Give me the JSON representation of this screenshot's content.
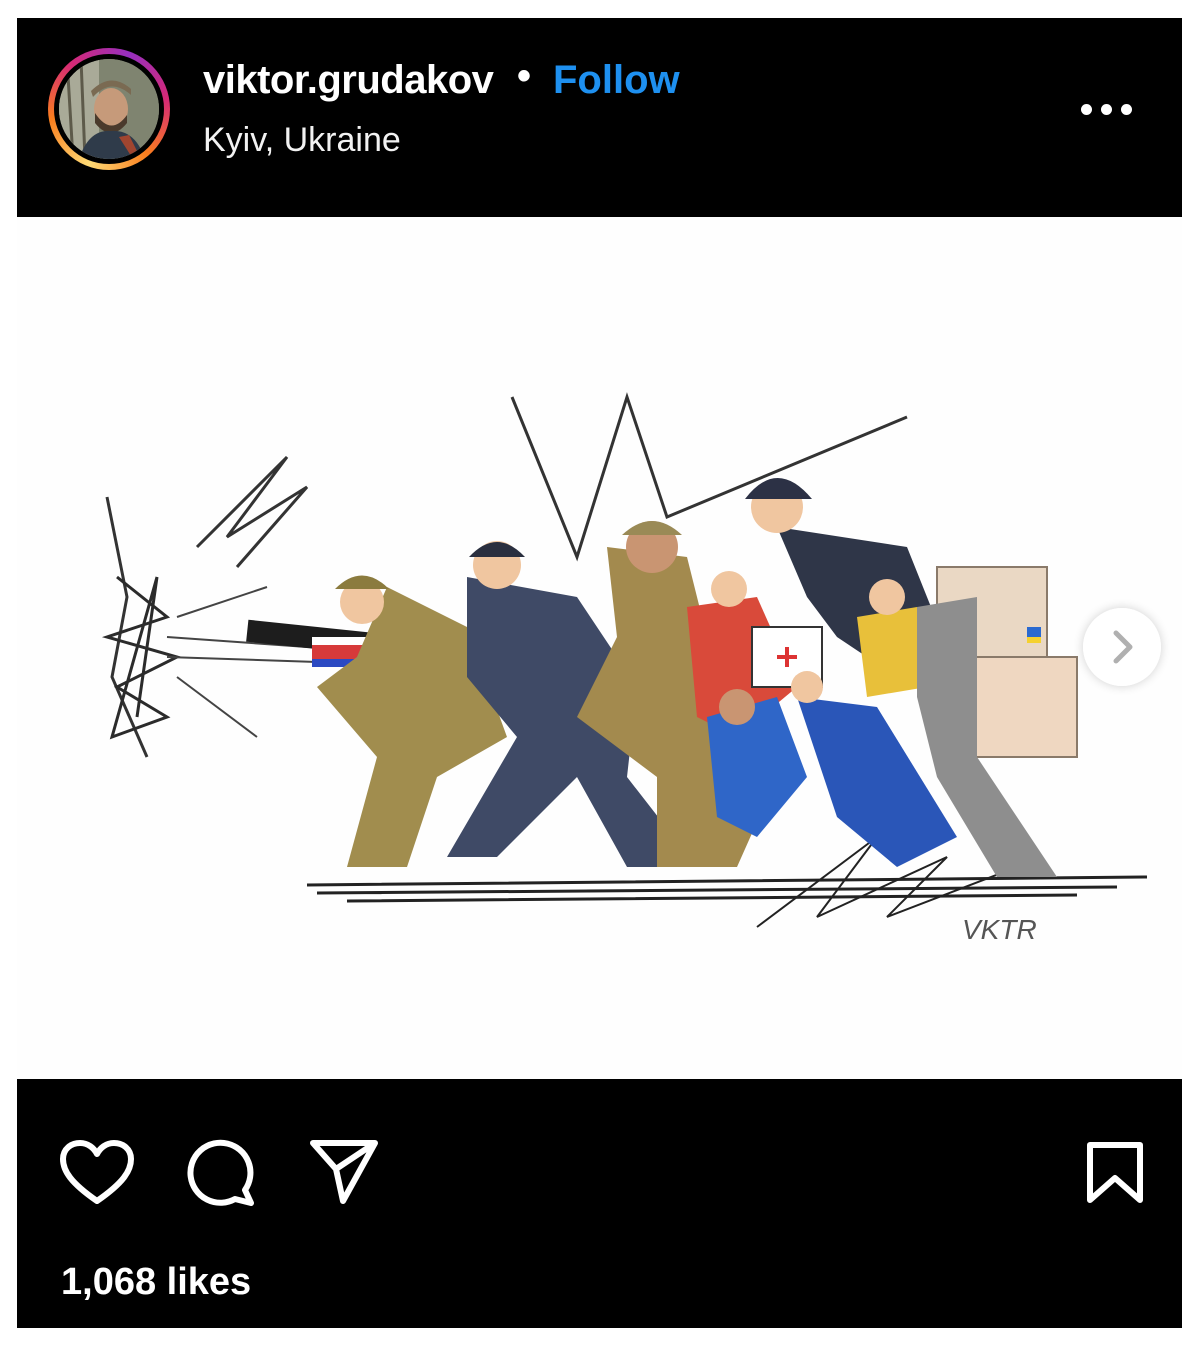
{
  "header": {
    "username": "viktor.grudakov",
    "separator": "•",
    "follow_label": "Follow",
    "location": "Kyiv, Ukraine"
  },
  "post": {
    "signature": "VKTR",
    "likes": "1,068 likes"
  },
  "icons": {
    "more": "more-options-icon",
    "next": "chevron-right-icon",
    "like": "heart-icon",
    "comment": "comment-icon",
    "share": "send-icon",
    "save": "bookmark-icon"
  },
  "colors": {
    "background": "#000000",
    "text": "#ffffff",
    "follow": "#1e90f0"
  }
}
